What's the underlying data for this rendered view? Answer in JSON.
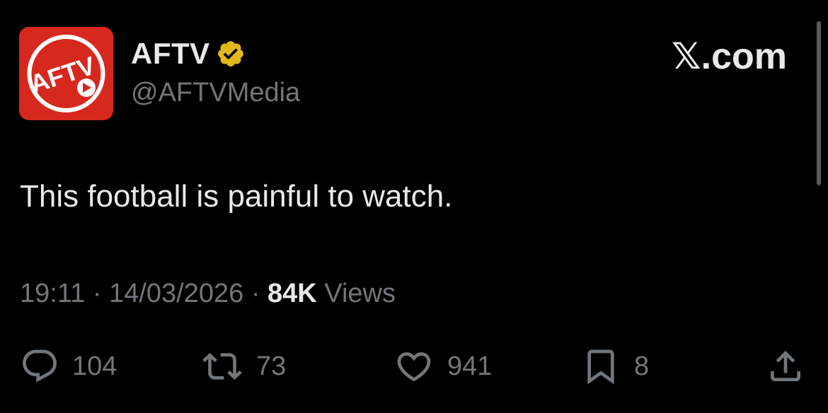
{
  "account": {
    "display_name": "AFTV",
    "handle": "@AFTVMedia",
    "avatar_text": "AFTV",
    "avatar_color": "#d7281e",
    "verified_color": "#e2b719"
  },
  "brand": {
    "x_glyph": "𝕏",
    "suffix": ".com"
  },
  "tweet": {
    "text": "This football is painful to watch."
  },
  "meta": {
    "time": "19:11",
    "separator": "·",
    "date": "14/03/2026",
    "views_count": "84K",
    "views_label": "Views"
  },
  "actions": {
    "replies": "104",
    "reposts": "73",
    "likes": "941",
    "bookmarks": "8"
  },
  "icons": {
    "reply": "speech-bubble-icon",
    "repost": "repost-arrows-icon",
    "like": "heart-icon",
    "bookmark": "bookmark-icon",
    "share": "share-upload-icon",
    "verified": "verified-badge-icon"
  }
}
